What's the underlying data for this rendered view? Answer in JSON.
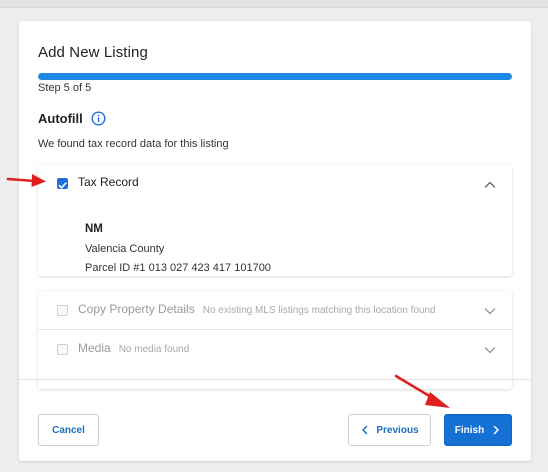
{
  "dialog": {
    "title": "Add New Listing",
    "progress_fraction": 1.0,
    "step_label": "Step 5 of 5"
  },
  "autofill": {
    "heading": "Autofill",
    "info_icon": "info-circle-icon",
    "subtext": "We found tax record data for this listing"
  },
  "tax_record": {
    "label": "Tax Record",
    "checked": true,
    "expanded": true,
    "state": "NM",
    "county": "Valencia County",
    "parcel": "Parcel ID #1 013 027 423 417 101700"
  },
  "copy_property": {
    "label": "Copy Property Details",
    "note": "No existing MLS listings matching this location found",
    "checked": false,
    "disabled": true
  },
  "media": {
    "label": "Media",
    "note": "No media found",
    "checked": false,
    "disabled": true
  },
  "footer": {
    "cancel_label": "Cancel",
    "previous_label": "Previous",
    "finish_label": "Finish"
  },
  "colors": {
    "accent": "#1e88e5",
    "primary_button": "#1570d4",
    "annotation_arrow": "#e02020"
  }
}
